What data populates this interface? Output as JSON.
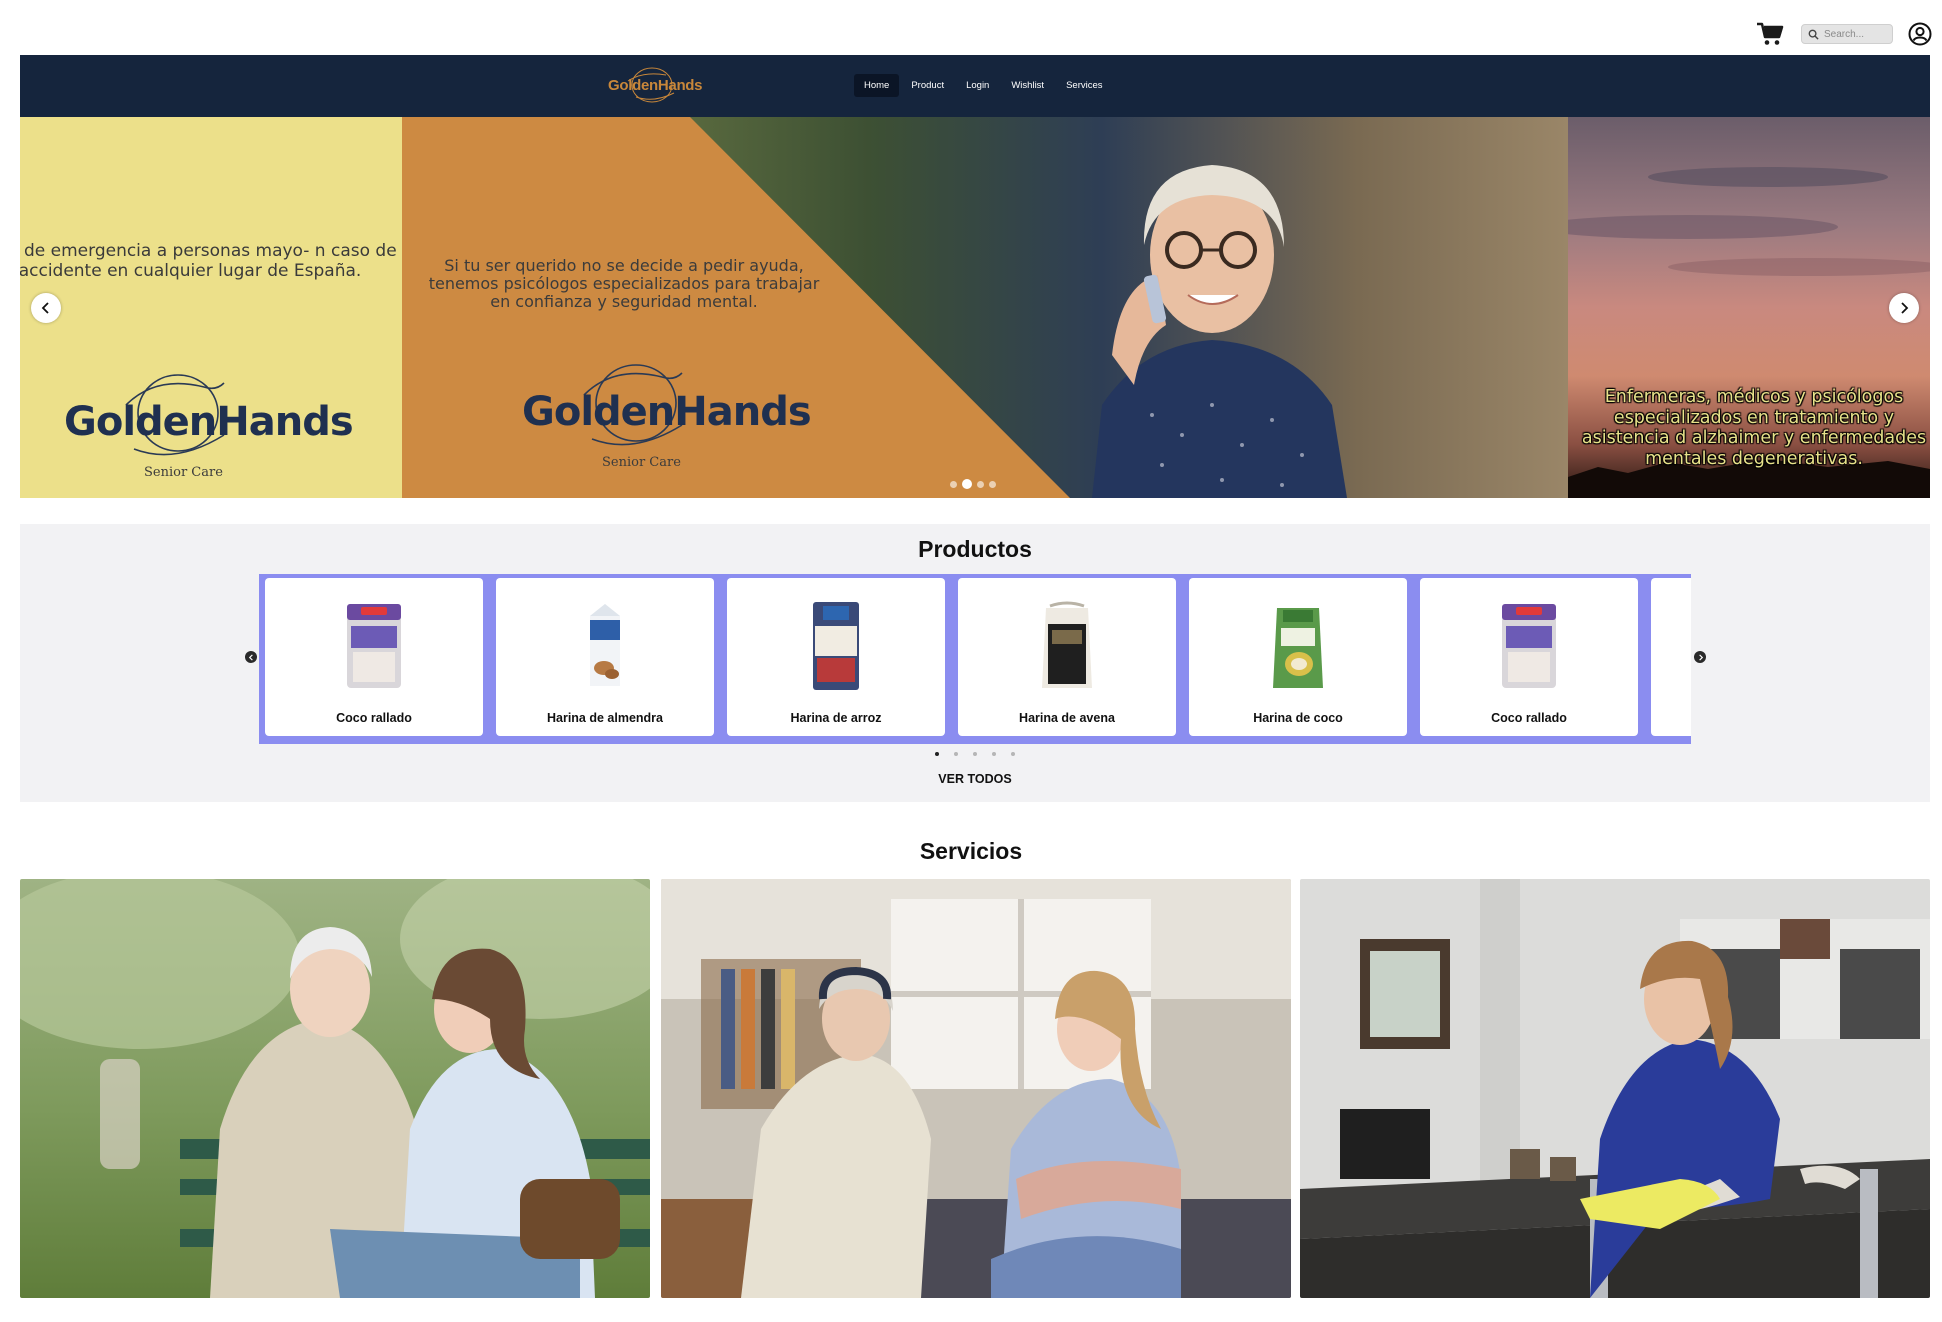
{
  "topbar": {
    "search_placeholder": "Search..."
  },
  "header": {
    "logo_text": "GoldenHands",
    "nav": [
      {
        "label": "Home",
        "active": true
      },
      {
        "label": "Product",
        "active": false
      },
      {
        "label": "Login",
        "active": false
      },
      {
        "label": "Wishlist",
        "active": false
      },
      {
        "label": "Services",
        "active": false
      }
    ]
  },
  "hero": {
    "slides": [
      {
        "text": "ncia de emergencia a personas mayo- n caso de accidente en cualquier lugar de España.",
        "brand": "GoldenHands",
        "brand_sub": "Senior Care"
      },
      {
        "text": "Si tu ser querido no se decide a pedir ayuda, tenemos psicólogos especializados para trabajar en confianza y seguridad mental.",
        "brand": "GoldenHands",
        "brand_sub": "Senior Care"
      },
      {
        "text": "Enfermeras, médicos y psicólogos especializados en tratamiento y asistencia d alzhaimer y enfermedades mentales degenerativas."
      }
    ],
    "dots": 4,
    "active_dot": 1
  },
  "products": {
    "title": "Productos",
    "items": [
      {
        "name": "Coco rallado",
        "icon": "coconut-bag"
      },
      {
        "name": "Harina de almendra",
        "icon": "almond-carton"
      },
      {
        "name": "Harina de arroz",
        "icon": "rice-flour-bag"
      },
      {
        "name": "Harina de avena",
        "icon": "oat-flour-bag"
      },
      {
        "name": "Harina de coco",
        "icon": "coconut-flour-bag"
      },
      {
        "name": "Coco rallado",
        "icon": "coconut-bag"
      }
    ],
    "dots": 5,
    "active_dot": 0,
    "view_all": "VER TODOS"
  },
  "services": {
    "title": "Servicios",
    "cards": [
      {
        "icon": "caregiver-park-photo"
      },
      {
        "icon": "companion-home-photo"
      },
      {
        "icon": "cleaning-service-photo"
      }
    ]
  },
  "colors": {
    "navbar": "#15253d",
    "accent_orange": "#cd8a42",
    "slide_yellow": "#ece08a",
    "product_strip": "#8b8df0",
    "section_bg": "#f2f2f4"
  }
}
